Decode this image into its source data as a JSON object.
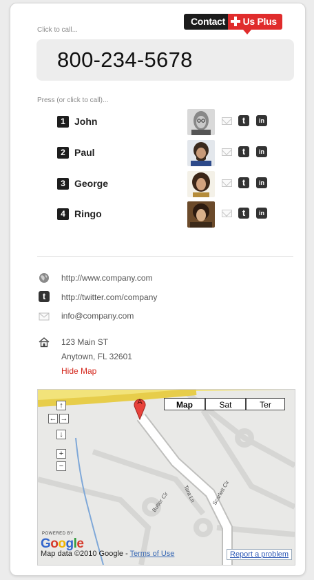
{
  "header": {
    "click_label": "Click to call...",
    "logo_left": "Contact",
    "logo_right": "Us Plus"
  },
  "phone": {
    "number": "800-234-5678"
  },
  "press_label": "Press (or click to call)...",
  "people": [
    {
      "key": "1",
      "name": "John"
    },
    {
      "key": "2",
      "name": "Paul"
    },
    {
      "key": "3",
      "name": "George"
    },
    {
      "key": "4",
      "name": "Ringo"
    }
  ],
  "links": {
    "website": "http://www.company.com",
    "twitter": "http://twitter.com/company",
    "email": "info@company.com"
  },
  "address": {
    "line1": "123 Main ST",
    "line2": "Anytown, FL 32601",
    "hide_map": "Hide Map"
  },
  "map": {
    "types": [
      "Map",
      "Sat",
      "Ter"
    ],
    "marker": "A",
    "streets": [
      "Butler Cir",
      "Tara Ln",
      "Scarlett Cir"
    ],
    "powered_by": "POWERED BY",
    "google": "Google",
    "copyright": "Map data ©2010 Google - ",
    "terms": "Terms of Use",
    "report": "Report a problem"
  },
  "colors": {
    "accent": "#e02c2c",
    "dark": "#1c1c1c",
    "link_red": "#d4271c"
  }
}
